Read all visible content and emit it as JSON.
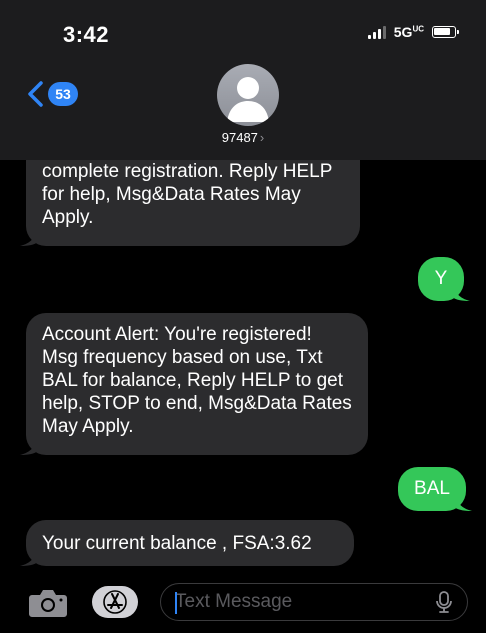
{
  "status_bar": {
    "time": "3:42",
    "network": "5G",
    "network_superscript": "UC"
  },
  "header": {
    "back_count": "53",
    "contact_name": "97487",
    "contact_chevron": "›"
  },
  "messages": [
    {
      "direction": "incoming",
      "text": "complete registration. Reply HELP for help, Msg&Data Rates May Apply."
    },
    {
      "direction": "outgoing",
      "text": "Y"
    },
    {
      "direction": "incoming",
      "text": "Account Alert: You're registered! Msg frequency based on use, Txt BAL for balance, Reply HELP to get help, STOP to end, Msg&Data Rates May Apply."
    },
    {
      "direction": "outgoing",
      "text": "BAL"
    },
    {
      "direction": "incoming",
      "text": "Your current balance , FSA:3.62"
    }
  ],
  "composer": {
    "placeholder": "Text Message",
    "value": ""
  },
  "colors": {
    "incoming": "#2c2c2e",
    "outgoing": "#34c759",
    "accent": "#2f84f5",
    "header": "#1c1c1e"
  },
  "icons": [
    "signal-icon",
    "battery-icon",
    "back-chevron-icon",
    "avatar-icon",
    "camera-icon",
    "app-store-icon",
    "microphone-icon"
  ]
}
